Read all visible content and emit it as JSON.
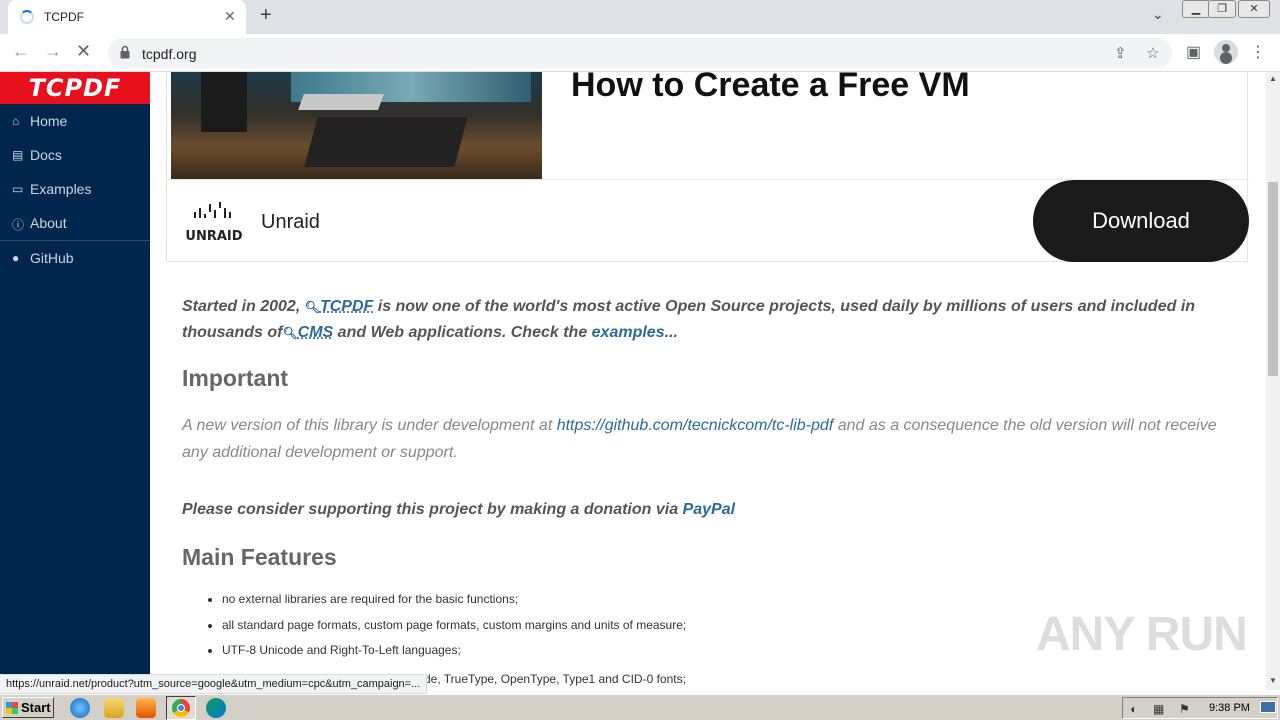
{
  "browser": {
    "tab_title": "TCPDF",
    "url": "tcpdf.org",
    "status_url": "https://unraid.net/product?utm_source=google&utm_medium=cpc&utm_campaign=..."
  },
  "sidebar": {
    "logo": "TCPDF",
    "items": [
      {
        "label": "Home",
        "icon": "home-icon"
      },
      {
        "label": "Docs",
        "icon": "document-icon"
      },
      {
        "label": "Examples",
        "icon": "file-icon"
      },
      {
        "label": "About",
        "icon": "info-icon"
      },
      {
        "label": "GitHub",
        "icon": "github-icon"
      }
    ]
  },
  "ad": {
    "headline": "How to Create a Free VM",
    "brand_logo_text": "UNRAID",
    "brand_name": "Unraid",
    "button": "Download"
  },
  "intro": {
    "p1": "Started in 2002,",
    "link1": "TCPDF",
    "p2": " is now one of the world's most active Open Source projects, used daily by millions of users and included in thousands of",
    "link2": "CMS",
    "p3": " and Web applications. Check the ",
    "link3": "examples",
    "p4": "..."
  },
  "important": {
    "heading": "Important",
    "text1": "A new version of this library is under development at ",
    "link": "https://github.com/tecnickcom/tc-lib-pdf",
    "text2": " and as a consequence the old version will not receive any additional development or support."
  },
  "donate": {
    "text": "Please consider supporting this project by making a donation via ",
    "link": "PayPal"
  },
  "features": {
    "heading": "Main Features",
    "items": [
      "no external libraries are required for the basic functions;",
      "all standard page formats, custom page formats, custom margins and units of measure;",
      "UTF-8 Unicode and Right-To-Left languages;",
      "de, TrueType, OpenType, Type1 and CID-0 fonts;"
    ]
  },
  "watermark": "ANY RUN",
  "taskbar": {
    "start": "Start",
    "clock": "9:38 PM"
  }
}
